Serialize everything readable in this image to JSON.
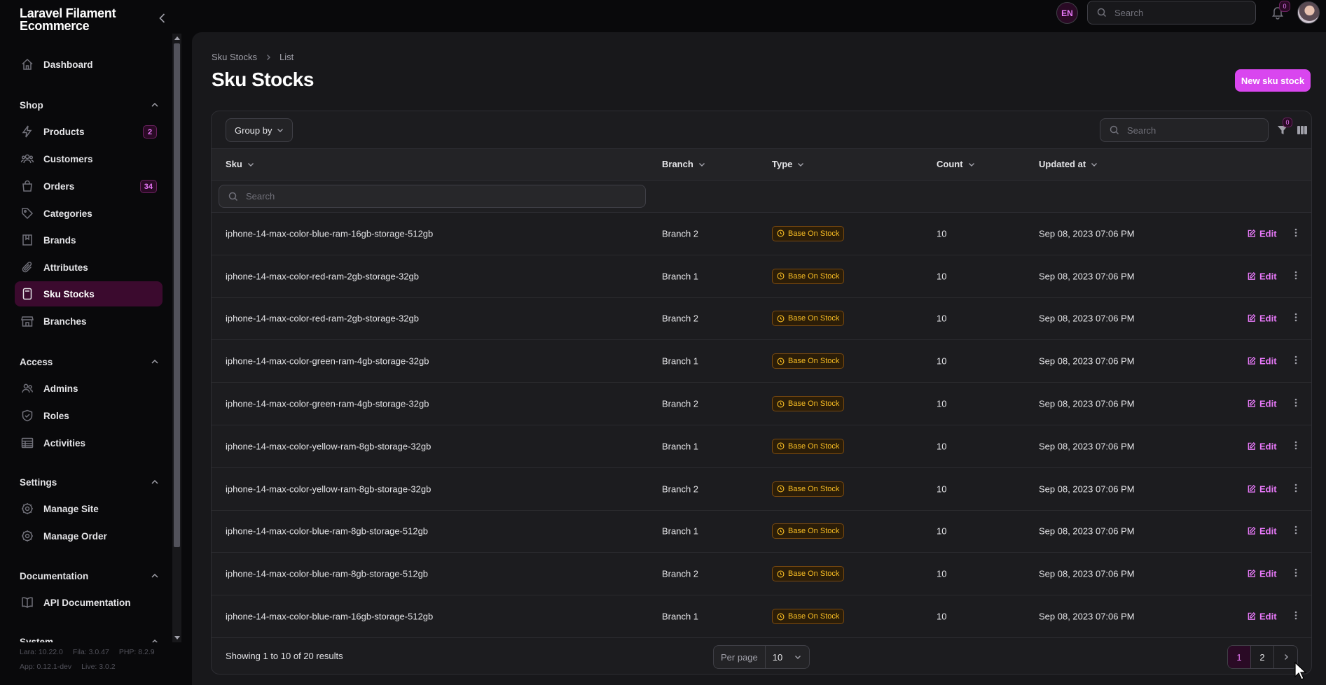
{
  "brand": {
    "line1": "Laravel Filament",
    "line2": "Ecommerce"
  },
  "sidebar": {
    "dashboard": "Dashboard",
    "groups": {
      "shop": "Shop",
      "access": "Access",
      "settings": "Settings",
      "documentation": "Documentation",
      "system": "System"
    },
    "items": {
      "products": {
        "label": "Products",
        "badge": "2"
      },
      "customers": {
        "label": "Customers"
      },
      "orders": {
        "label": "Orders",
        "badge": "34"
      },
      "categories": {
        "label": "Categories"
      },
      "brands": {
        "label": "Brands"
      },
      "attributes": {
        "label": "Attributes"
      },
      "sku_stocks": {
        "label": "Sku Stocks"
      },
      "branches": {
        "label": "Branches"
      },
      "admins": {
        "label": "Admins"
      },
      "roles": {
        "label": "Roles"
      },
      "activities": {
        "label": "Activities"
      },
      "manage_site": {
        "label": "Manage Site"
      },
      "manage_order": {
        "label": "Manage Order"
      },
      "api_docs": {
        "label": "API Documentation"
      }
    },
    "footer": {
      "lara": "Lara: 10.22.0",
      "fila": "Fila: 3.0.47",
      "php": "PHP: 8.2.9",
      "app": "App: 0.12.1-dev",
      "live": "Live: 3.0.2"
    }
  },
  "topbar": {
    "lang": "EN",
    "search_placeholder": "Search",
    "notifications": "0"
  },
  "page": {
    "breadcrumb": [
      "Sku Stocks",
      "List"
    ],
    "title": "Sku Stocks",
    "new_button": "New sku stock"
  },
  "table": {
    "group_by": "Group by",
    "search_placeholder": "Search",
    "filter_count": "0",
    "columns": [
      "Sku",
      "Branch",
      "Type",
      "Count",
      "Updated at"
    ],
    "column_search_placeholder": "Search",
    "edit_label": "Edit",
    "rows": [
      {
        "sku": "iphone-14-max-color-blue-ram-16gb-storage-512gb",
        "branch": "Branch 2",
        "type": "Base On Stock",
        "count": "10",
        "updated": "Sep 08, 2023 07:06 PM"
      },
      {
        "sku": "iphone-14-max-color-red-ram-2gb-storage-32gb",
        "branch": "Branch 1",
        "type": "Base On Stock",
        "count": "10",
        "updated": "Sep 08, 2023 07:06 PM"
      },
      {
        "sku": "iphone-14-max-color-red-ram-2gb-storage-32gb",
        "branch": "Branch 2",
        "type": "Base On Stock",
        "count": "10",
        "updated": "Sep 08, 2023 07:06 PM"
      },
      {
        "sku": "iphone-14-max-color-green-ram-4gb-storage-32gb",
        "branch": "Branch 1",
        "type": "Base On Stock",
        "count": "10",
        "updated": "Sep 08, 2023 07:06 PM"
      },
      {
        "sku": "iphone-14-max-color-green-ram-4gb-storage-32gb",
        "branch": "Branch 2",
        "type": "Base On Stock",
        "count": "10",
        "updated": "Sep 08, 2023 07:06 PM"
      },
      {
        "sku": "iphone-14-max-color-yellow-ram-8gb-storage-32gb",
        "branch": "Branch 1",
        "type": "Base On Stock",
        "count": "10",
        "updated": "Sep 08, 2023 07:06 PM"
      },
      {
        "sku": "iphone-14-max-color-yellow-ram-8gb-storage-32gb",
        "branch": "Branch 2",
        "type": "Base On Stock",
        "count": "10",
        "updated": "Sep 08, 2023 07:06 PM"
      },
      {
        "sku": "iphone-14-max-color-blue-ram-8gb-storage-512gb",
        "branch": "Branch 1",
        "type": "Base On Stock",
        "count": "10",
        "updated": "Sep 08, 2023 07:06 PM"
      },
      {
        "sku": "iphone-14-max-color-blue-ram-8gb-storage-512gb",
        "branch": "Branch 2",
        "type": "Base On Stock",
        "count": "10",
        "updated": "Sep 08, 2023 07:06 PM"
      },
      {
        "sku": "iphone-14-max-color-blue-ram-16gb-storage-512gb",
        "branch": "Branch 1",
        "type": "Base On Stock",
        "count": "10",
        "updated": "Sep 08, 2023 07:06 PM"
      }
    ],
    "showing": "Showing 1 to 10 of 20 results",
    "per_page_label": "Per page",
    "per_page_value": "10",
    "pages": [
      "1",
      "2"
    ]
  },
  "colors": {
    "accent": "#d946ef",
    "badge_warning": "#fbbf24"
  }
}
